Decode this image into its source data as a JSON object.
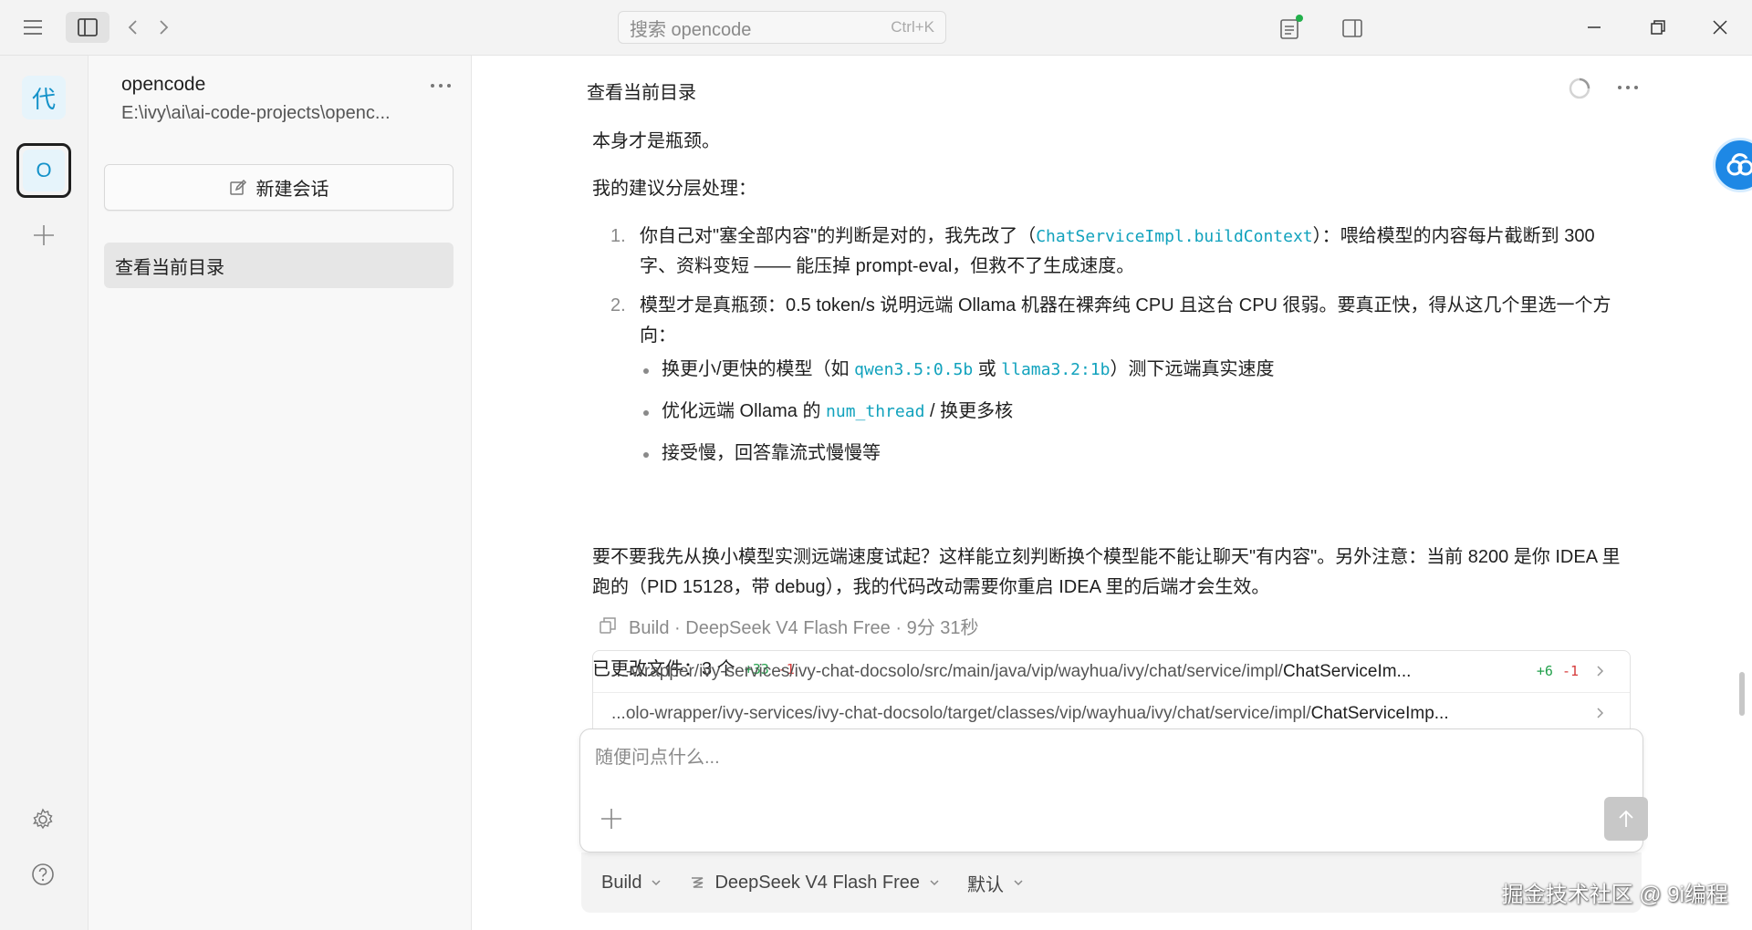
{
  "titlebar": {
    "search_placeholder": "搜索 opencode",
    "search_shortcut": "Ctrl+K"
  },
  "rail": {
    "project_badge": "代",
    "active_project_badge": "O"
  },
  "sidebar": {
    "project_name": "opencode",
    "project_path": "E:\\ivy\\ai\\ai-code-projects\\openc...",
    "new_session_label": "新建会话",
    "sessions": [
      {
        "label": "查看当前目录"
      }
    ]
  },
  "main": {
    "title": "查看当前目录",
    "message": {
      "p1": "本身才是瓶颈。",
      "p2": "我的建议分层处理：",
      "list": [
        {
          "num": "1.",
          "text_a": "你自己对\"塞全部内容\"的判断是对的，我先改了（",
          "code": "ChatServiceImpl.buildContext",
          "text_b": "）：喂给模型的内容每片截断到 300 字、资料变短 —— 能压掉 prompt-eval，但救不了生成速度。"
        },
        {
          "num": "2.",
          "text": "模型才是真瓶颈：0.5 token/s 说明远端 Ollama 机器在裸奔纯 CPU 且这台 CPU 很弱。要真正快，得从这几个里选一个方向：",
          "bullets": [
            {
              "a": "换更小/更快的模型（如 ",
              "code1": "qwen3.5:0.5b",
              "mid": " 或 ",
              "code2": "llama3.2:1b",
              "b": "）测下远端真实速度"
            },
            {
              "a": "优化远端 Ollama 的 ",
              "code1": "num_thread",
              "b": " / 换更多核"
            },
            {
              "a": "接受慢，回答靠流式慢慢等"
            }
          ]
        }
      ],
      "p3": "要不要我先从换小模型实测远端速度试起？这样能立刻判断换个模型能不能让聊天\"有内容\"。另外注意：当前 8200 是你 IDEA 里跑的（PID 15128，带 debug），我的代码改动需要你重启 IDEA 里的后端才会生效。"
    },
    "meta": "Build · DeepSeek V4 Flash Free · 9分 31秒",
    "changed_files_label": "已更改文件：3 个",
    "changed_plus": "+33",
    "changed_minus": "-1",
    "files": [
      {
        "path": "...-wrapper/ivy-services/ivy-chat-docsolo/src/main/java/vip/wayhua/ivy/chat/service/impl/",
        "name": "ChatServiceIm...",
        "plus": "+6",
        "minus": "-1"
      },
      {
        "path": "...olo-wrapper/ivy-services/ivy-chat-docsolo/target/classes/vip/wayhua/ivy/chat/service/impl/",
        "name": "ChatServiceImp...",
        "plus": "",
        "minus": ""
      }
    ],
    "composer_placeholder": "随便问点什么...",
    "toolbar": {
      "mode": "Build",
      "model": "DeepSeek V4 Flash Free",
      "variant": "默认"
    },
    "watermark": "掘金技术社区 @ 9i编程"
  },
  "colors": {
    "code": "#11a2bd",
    "plus": "#22a04b",
    "minus": "#d63a3a",
    "accent": "#1492c9"
  }
}
